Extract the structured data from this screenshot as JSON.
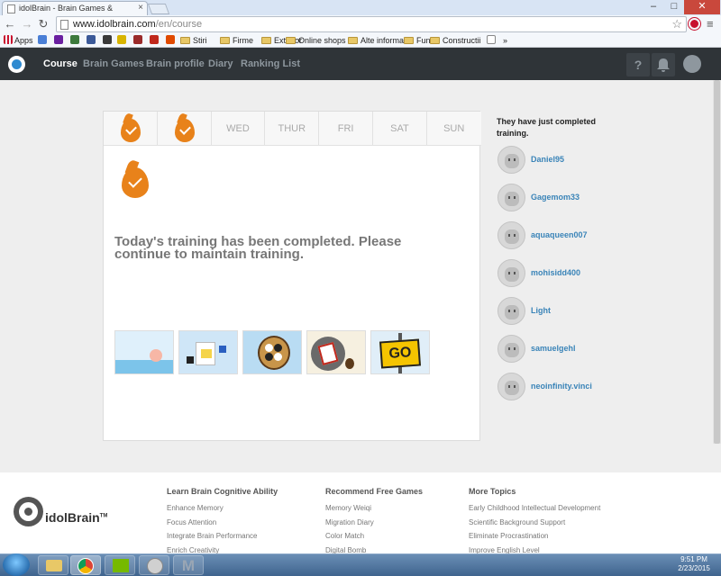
{
  "browser": {
    "tab_title": "idolBrain - Brain Games &",
    "url_host": "www.idolbrain.com",
    "url_path": "/en/course",
    "window_controls": [
      "–",
      "□",
      "✕"
    ],
    "bookmarks": [
      {
        "label": "Apps",
        "kind": "apps",
        "color": "#c8102e"
      },
      {
        "label": "",
        "kind": "icon",
        "color": "#4a7fd6"
      },
      {
        "label": "",
        "kind": "icon",
        "color": "#6a1fa0"
      },
      {
        "label": "",
        "kind": "icon",
        "color": "#3d7a3d"
      },
      {
        "label": "",
        "kind": "icon",
        "color": "#3b5998"
      },
      {
        "label": "",
        "kind": "icon",
        "color": "#3a3a3a"
      },
      {
        "label": "",
        "kind": "icon",
        "color": "#d8b400"
      },
      {
        "label": "",
        "kind": "icon",
        "color": "#9a2a2a"
      },
      {
        "label": "",
        "kind": "icon",
        "color": "#c0281c"
      },
      {
        "label": "",
        "kind": "icon",
        "color": "#e04a00"
      },
      {
        "label": "Stiri",
        "kind": "folder"
      },
      {
        "label": "Firme",
        "kind": "folder"
      },
      {
        "label": "Exterior",
        "kind": "folder"
      },
      {
        "label": "Online shops",
        "kind": "folder"
      },
      {
        "label": "Alte informatii",
        "kind": "folder"
      },
      {
        "label": "Fun",
        "kind": "folder"
      },
      {
        "label": "Constructii",
        "kind": "folder"
      },
      {
        "label": "",
        "kind": "page"
      },
      {
        "label": "»",
        "kind": "more"
      }
    ]
  },
  "nav": {
    "items": [
      "Course",
      "Brain Games",
      "Brain profile",
      "Diary",
      "Ranking List"
    ],
    "active": "Course",
    "help_glyph": "?"
  },
  "course": {
    "days": [
      {
        "label": "",
        "done": true
      },
      {
        "label": "",
        "done": true
      },
      {
        "label": "WED",
        "done": false
      },
      {
        "label": "THUR",
        "done": false
      },
      {
        "label": "FRI",
        "done": false
      },
      {
        "label": "SAT",
        "done": false
      },
      {
        "label": "SUN",
        "done": false
      }
    ],
    "message": "Today's training has been completed. Please continue to maintain training.",
    "games": [
      {
        "name": "game-thumb-sea",
        "bg": "#dff0fb",
        "accent": "#f7b7a6"
      },
      {
        "name": "game-thumb-cards",
        "bg": "#cfe6f7",
        "accent": "#f5d44a"
      },
      {
        "name": "game-thumb-weiqi",
        "bg": "#b9dcf3",
        "accent": "#c8954a"
      },
      {
        "name": "game-thumb-bomb",
        "bg": "#f6f0e0",
        "accent": "#c0281c"
      },
      {
        "name": "game-thumb-go",
        "bg": "#e0eef8",
        "accent": "#f5c400",
        "text": "GO"
      }
    ]
  },
  "sidebar": {
    "title": "They have just completed training.",
    "users": [
      "Daniel95",
      "Gagemom33",
      "aquaqueen007",
      "mohisidd400",
      "Light",
      "samuelgehl",
      "neoinfinity.vinci"
    ]
  },
  "footer": {
    "brand": "idolBrain",
    "brand_mark": "TM",
    "columns": [
      {
        "title": "Learn Brain Cognitive Ability",
        "items": [
          "Enhance Memory",
          "Focus Attention",
          "Integrate Brain Performance",
          "Enrich Creativity"
        ]
      },
      {
        "title": "Recommend Free Games",
        "items": [
          "Memory Weiqi",
          "Migration Diary",
          "Color Match",
          "Digital Bomb"
        ]
      },
      {
        "title": "More Topics",
        "items": [
          "Early Childhood Intellectual Development",
          "Scientific Background Support",
          "Eliminate Procrastination",
          "Improve English Level"
        ]
      }
    ]
  },
  "taskbar": {
    "time": "9:51 PM",
    "date": "2/23/2015"
  }
}
